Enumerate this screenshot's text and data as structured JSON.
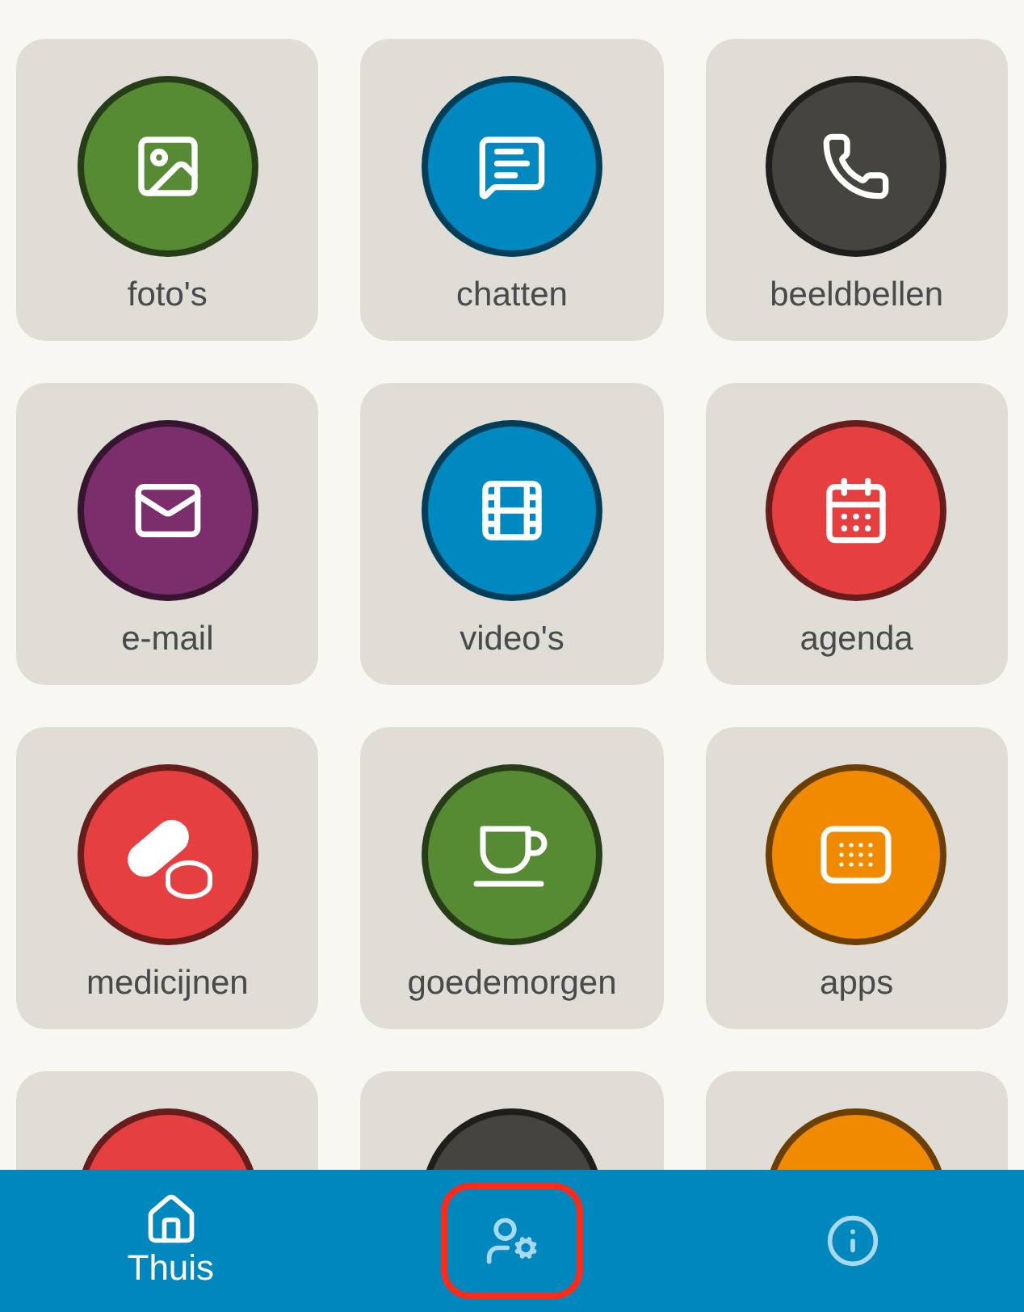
{
  "tiles": [
    {
      "label": "foto's",
      "color": "#568a33"
    },
    {
      "label": "chatten",
      "color": "#0088c0"
    },
    {
      "label": "beeldbellen",
      "color": "#45443e"
    },
    {
      "label": "e-mail",
      "color": "#7b2e6b"
    },
    {
      "label": "video's",
      "color": "#0088c0"
    },
    {
      "label": "agenda",
      "color": "#e5403f"
    },
    {
      "label": "medicijnen",
      "color": "#e5403f"
    },
    {
      "label": "goedemorgen",
      "color": "#568a33"
    },
    {
      "label": "apps",
      "color": "#f08a00"
    },
    {
      "color": "#e5403f"
    },
    {
      "color": "#45443e"
    },
    {
      "color": "#f08a00"
    }
  ],
  "nav": [
    {
      "label": "Thuis",
      "selected": true,
      "highlighted": false
    },
    {
      "selected": false,
      "highlighted": true
    },
    {
      "selected": false,
      "highlighted": false
    }
  ]
}
